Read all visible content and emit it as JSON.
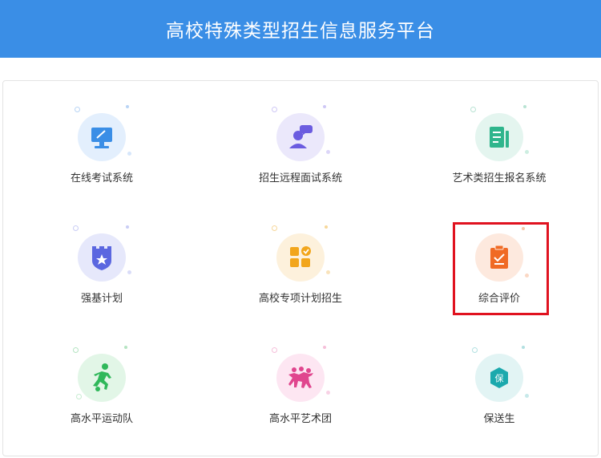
{
  "header": {
    "title": "高校特殊类型招生信息服务平台"
  },
  "colors": {
    "header_bg": "#3a8ee6",
    "highlight": "#e0121f"
  },
  "tiles": [
    {
      "label": "在线考试系统",
      "icon": "monitor-icon",
      "bg": "#e3effd",
      "fg": "#3a8ee6"
    },
    {
      "label": "招生远程面试系统",
      "icon": "interview-person-icon",
      "bg": "#ebe8fb",
      "fg": "#6b5ce0"
    },
    {
      "label": "艺术类招生报名系统",
      "icon": "registration-form-icon",
      "bg": "#e4f5ef",
      "fg": "#2fb58c"
    },
    {
      "label": "强基计划",
      "icon": "shield-star-icon",
      "bg": "#e6e8fb",
      "fg": "#5b67e0"
    },
    {
      "label": "高校专项计划招生",
      "icon": "apps-grid-check-icon",
      "bg": "#fdf1dc",
      "fg": "#f2a61c"
    },
    {
      "label": "综合评价",
      "icon": "clipboard-check-icon",
      "bg": "#fde9de",
      "fg": "#f06a24"
    },
    {
      "label": "高水平运动队",
      "icon": "running-athlete-icon",
      "bg": "#e2f6e7",
      "fg": "#2fb85a"
    },
    {
      "label": "高水平艺术团",
      "icon": "dancers-icon",
      "bg": "#fde6f2",
      "fg": "#e0468e"
    },
    {
      "label": "保送生",
      "icon": "bao-badge-icon",
      "bg": "#e2f4f4",
      "fg": "#1ba9ad"
    }
  ]
}
